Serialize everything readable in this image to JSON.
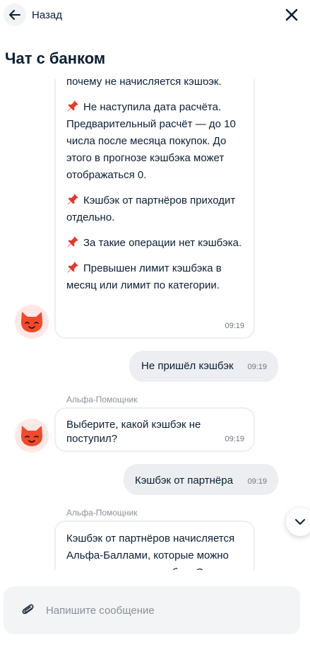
{
  "header": {
    "back_label": "Назад",
    "title": "Чат с банком"
  },
  "messages": {
    "m1": {
      "partial_line": "почему не начисляется кэшбэк.",
      "items": [
        "Не наступила дата расчёта. Предварительный расчёт — до 10 числа после месяца покупок. До этого в прогнозе кэшбэка может отображаться 0.",
        "Кэшбэк от партнёров приходит отдельно.",
        "За такие операции нет кэшбэка.",
        "Превышен лимит кэшбэка в месяц или лимит по категории."
      ],
      "time": "09:19"
    },
    "m2": {
      "text": "Не пришёл кэшбэк",
      "time": "09:19"
    },
    "m3": {
      "sender": "Альфа-Помощник",
      "text": "Выберите, какой кэшбэк не поступил?",
      "time": "09:19"
    },
    "m4": {
      "text": "Кэшбэк от партнёра",
      "time": "09:19"
    },
    "m5": {
      "sender": "Альфа-Помощник",
      "text": "Кэшбэк от партнёров начисляется Альфа-Баллами, которые можно сконвертировать в рубли. Один"
    }
  },
  "composer": {
    "placeholder": "Напишите сообщение"
  },
  "icons": {
    "back": "arrow-left-icon",
    "close": "close-icon",
    "pin": "pushpin-icon",
    "attach": "paperclip-icon",
    "scroll": "chevron-down-icon",
    "avatar": "cat-mascot-icon"
  },
  "colors": {
    "pin_red": "#e03a2f",
    "avatar_orange": "#ef4a2b",
    "text": "#0b1f35"
  }
}
